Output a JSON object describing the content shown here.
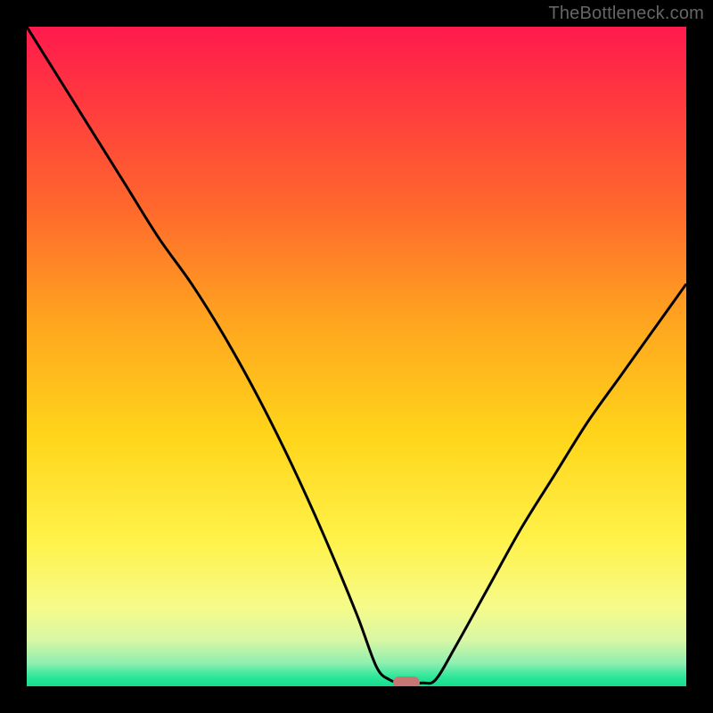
{
  "watermark": "TheBottleneck.com",
  "chart_data": {
    "type": "line",
    "title": "",
    "xlabel": "",
    "ylabel": "",
    "xlim": [
      0,
      100
    ],
    "ylim": [
      0,
      100
    ],
    "grid": false,
    "legend": false,
    "background_gradient_stops": [
      {
        "pos": 0.0,
        "color": "#ff1a4d"
      },
      {
        "pos": 0.12,
        "color": "#ff3b3e"
      },
      {
        "pos": 0.28,
        "color": "#ff6a2c"
      },
      {
        "pos": 0.45,
        "color": "#ffa61f"
      },
      {
        "pos": 0.62,
        "color": "#ffd51a"
      },
      {
        "pos": 0.78,
        "color": "#fff24a"
      },
      {
        "pos": 0.88,
        "color": "#f6fb8a"
      },
      {
        "pos": 0.93,
        "color": "#d9f7a4"
      },
      {
        "pos": 0.965,
        "color": "#8eefb0"
      },
      {
        "pos": 0.985,
        "color": "#2fe79a"
      },
      {
        "pos": 1.0,
        "color": "#15db8f"
      }
    ],
    "series": [
      {
        "name": "bottleneck-curve",
        "color": "#000000",
        "x": [
          0,
          5,
          10,
          15,
          20,
          25,
          30,
          35,
          40,
          45,
          50,
          53,
          55,
          57,
          60,
          62,
          65,
          70,
          75,
          80,
          85,
          90,
          95,
          100
        ],
        "y": [
          100,
          92,
          84,
          76,
          68,
          61,
          53,
          44,
          34,
          23,
          11,
          3,
          1,
          0.5,
          0.5,
          1,
          6,
          15,
          24,
          32,
          40,
          47,
          54,
          61
        ]
      }
    ],
    "marker": {
      "x": 57.5,
      "y": 0.5,
      "color": "#c77773"
    }
  }
}
